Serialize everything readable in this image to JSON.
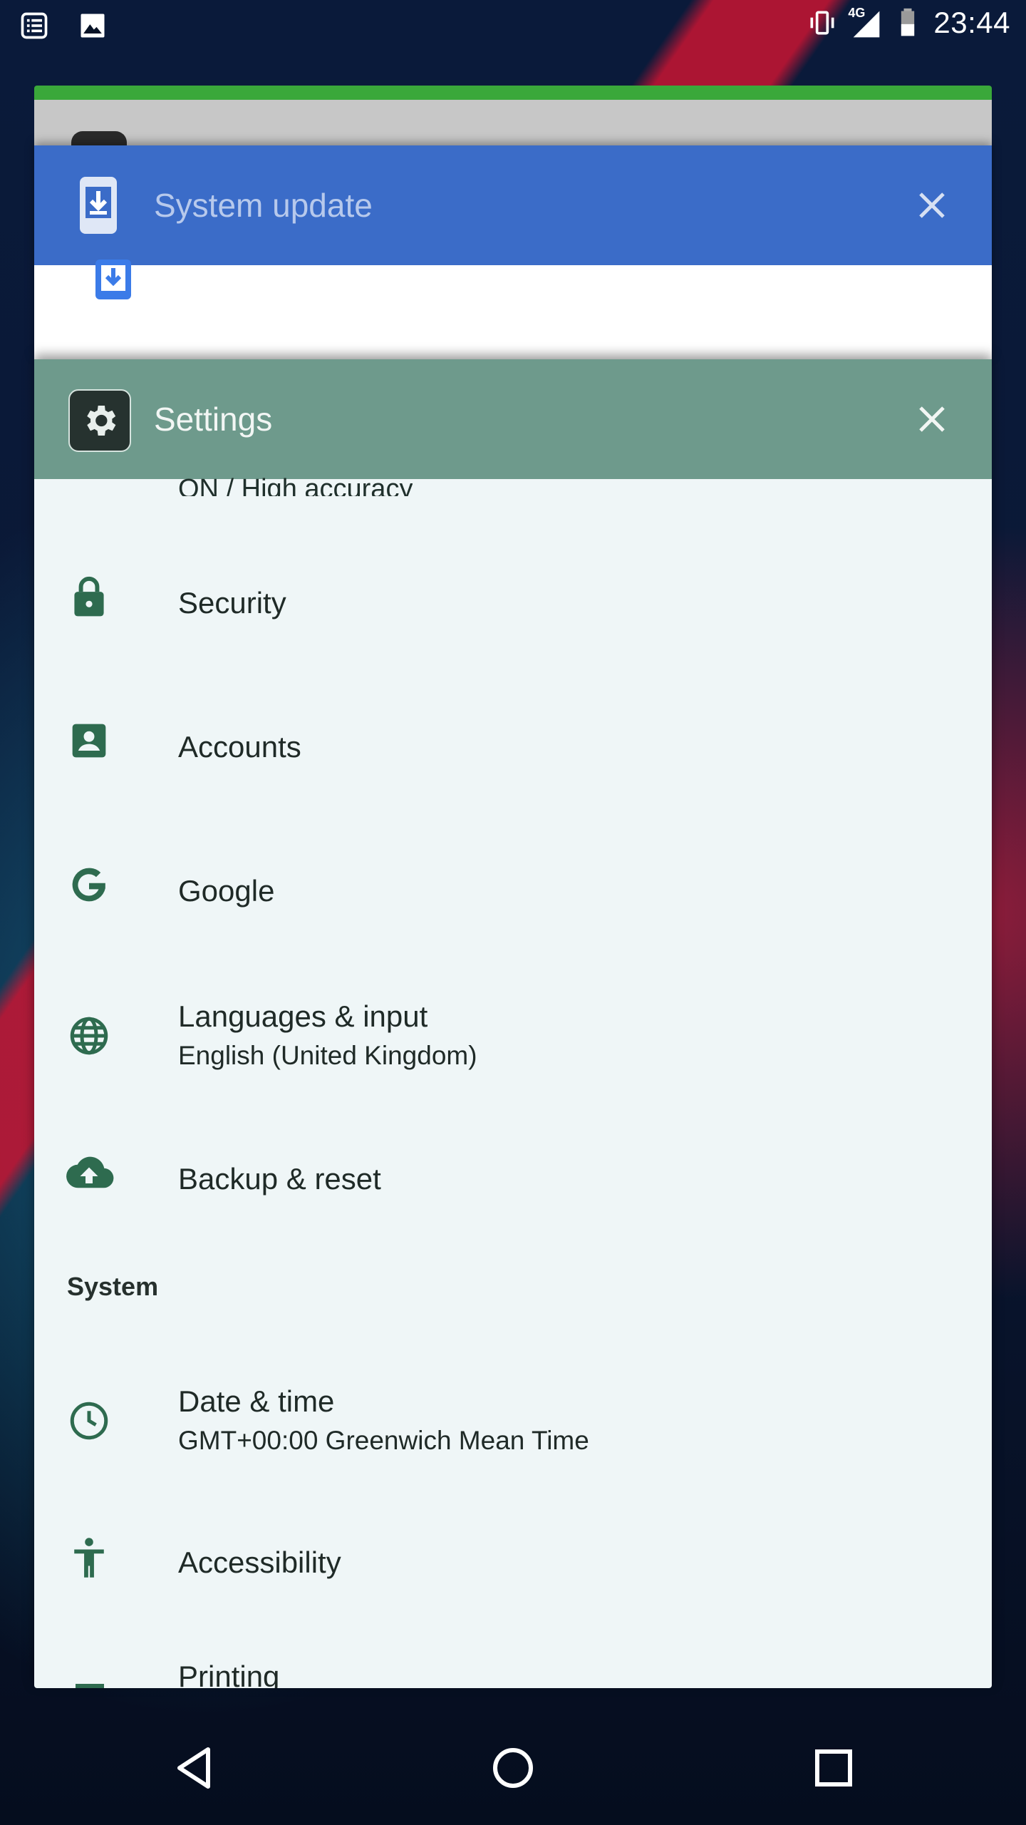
{
  "status_bar": {
    "left_icons": [
      "notification-list-icon",
      "image-icon"
    ],
    "network_type": "4G",
    "time": "23:44"
  },
  "cards": {
    "system_update": {
      "title": "System update",
      "icon": "system-update-icon"
    },
    "settings": {
      "title": "Settings",
      "icon": "gear-icon",
      "partial_top_text": "ON / High accuracy",
      "items": [
        {
          "title": "Security",
          "icon": "lock-icon"
        },
        {
          "title": "Accounts",
          "icon": "account-box-icon"
        },
        {
          "title": "Google",
          "icon": "google-icon"
        },
        {
          "title": "Languages & input",
          "subtitle": "English (United Kingdom)",
          "icon": "globe-icon"
        },
        {
          "title": "Backup & reset",
          "icon": "cloud-upload-icon"
        }
      ],
      "section_system": "System",
      "system_items": [
        {
          "title": "Date & time",
          "subtitle": "GMT+00:00 Greenwich Mean Time",
          "icon": "clock-icon"
        },
        {
          "title": "Accessibility",
          "icon": "accessibility-icon"
        },
        {
          "title": "Printing",
          "icon": "print-icon"
        }
      ]
    }
  },
  "colors": {
    "system_update_header": "#3b6cc8",
    "settings_header": "#6e9a8c",
    "settings_icon_tint": "#2e6b4f",
    "top_card_strip": "#3aa83a"
  },
  "nav_bar": {
    "buttons": [
      "back-icon",
      "home-icon",
      "recents-icon"
    ]
  }
}
